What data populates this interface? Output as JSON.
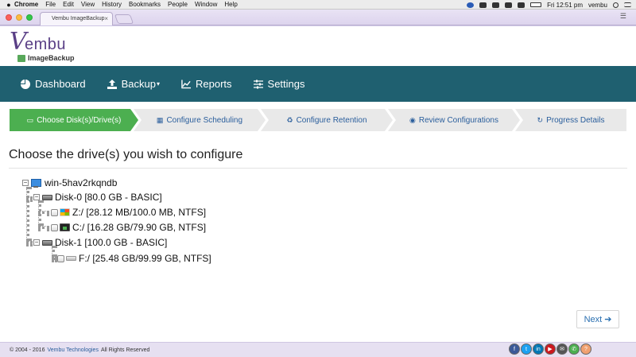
{
  "macos_menubar": {
    "app": "Chrome",
    "menus": [
      "File",
      "Edit",
      "View",
      "History",
      "Bookmarks",
      "People",
      "Window",
      "Help"
    ],
    "time": "Fri 12:51 pm",
    "user": "vembu"
  },
  "browser": {
    "tab_title": "Vembu ImageBackup",
    "tab_close": "×"
  },
  "logo": {
    "letter": "V",
    "name": "embu",
    "product": "ImageBackup"
  },
  "nav": {
    "items": [
      {
        "label": "Dashboard",
        "icon": "pie-chart-icon"
      },
      {
        "label": "Backup",
        "icon": "upload-icon",
        "caret": "▾"
      },
      {
        "label": "Reports",
        "icon": "line-chart-icon"
      },
      {
        "label": "Settings",
        "icon": "sliders-icon"
      }
    ]
  },
  "wizard": {
    "steps": [
      {
        "label": "Choose Disk(s)/Drive(s)",
        "icon": "hdd-icon",
        "glyph": "▭",
        "active": true
      },
      {
        "label": "Configure Scheduling",
        "icon": "calendar-icon",
        "glyph": "▦",
        "active": false
      },
      {
        "label": "Configure Retention",
        "icon": "recycle-icon",
        "glyph": "♻",
        "active": false
      },
      {
        "label": "Review Configurations",
        "icon": "eye-icon",
        "glyph": "◉",
        "active": false
      },
      {
        "label": "Progress Details",
        "icon": "refresh-icon",
        "glyph": "↻",
        "active": false
      }
    ]
  },
  "content": {
    "heading": "Choose the drive(s) you wish to configure",
    "tree": {
      "machine": "win-5hav2rkqndb",
      "disks": [
        {
          "label": "Disk-0 [80.0 GB - BASIC]",
          "drives": [
            {
              "label": "Z:/ [28.12 MB/100.0 MB, NTFS]",
              "checked": false
            },
            {
              "label": "C:/ [16.28 GB/79.90 GB, NTFS]",
              "checked": false
            }
          ]
        },
        {
          "label": "Disk-1 [100.0 GB - BASIC]",
          "drives": [
            {
              "label": "F:/ [25.48 GB/99.99 GB, NTFS]",
              "checked": false
            }
          ]
        }
      ]
    },
    "next_button": "Next",
    "next_arrow": "➔"
  },
  "footer": {
    "prefix": "© 2004 - 2016",
    "company": "Vembu Technologies",
    "suffix": "All Rights Reserved",
    "social": [
      {
        "icon": "facebook-icon",
        "glyph": "f",
        "color": "#3b5998"
      },
      {
        "icon": "twitter-icon",
        "glyph": "t",
        "color": "#1da1f2"
      },
      {
        "icon": "linkedin-icon",
        "glyph": "in",
        "color": "#0077b5"
      },
      {
        "icon": "youtube-icon",
        "glyph": "▶",
        "color": "#cc181e"
      },
      {
        "icon": "email-icon",
        "glyph": "✉",
        "color": "#555555"
      },
      {
        "icon": "phone-icon",
        "glyph": "✆",
        "color": "#4caf50"
      },
      {
        "icon": "help-icon",
        "glyph": "?",
        "color": "#f0a070"
      }
    ]
  }
}
